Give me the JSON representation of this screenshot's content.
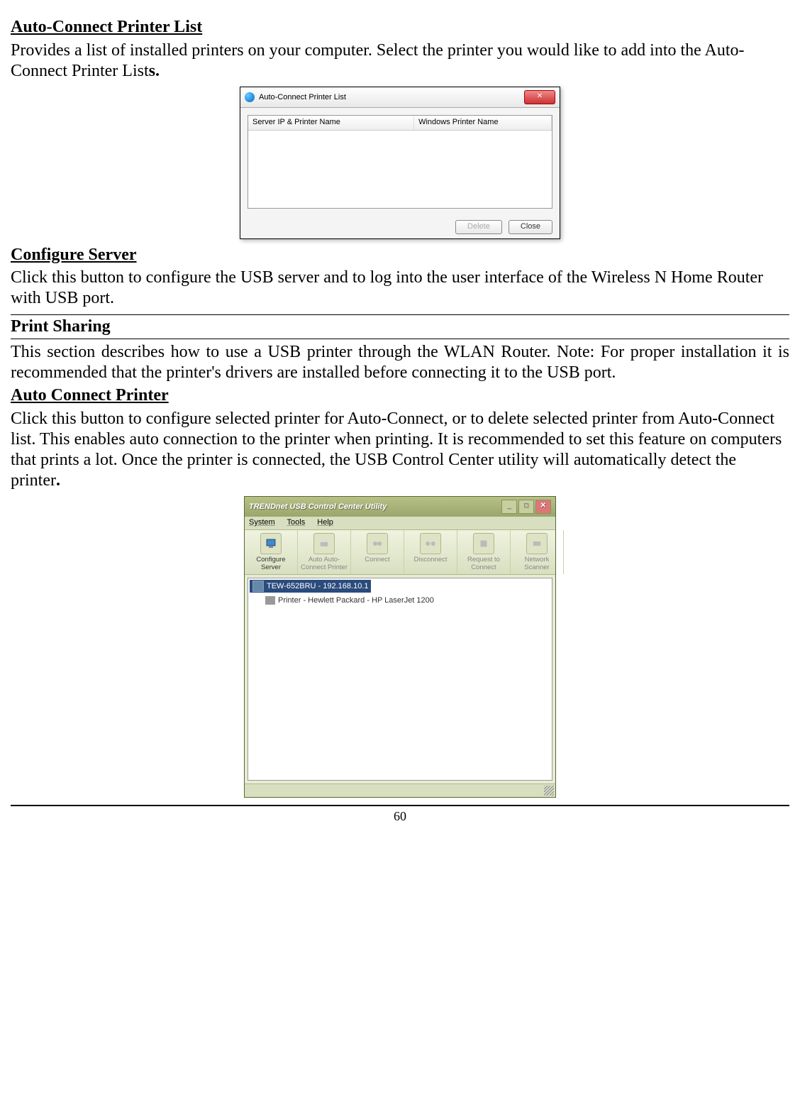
{
  "section1": {
    "heading": "Auto-Connect Printer List",
    "text_a": "Provides a list of installed printers on your computer. Select the printer you would like to add into the Auto-Connect Printer List",
    "text_b": "s."
  },
  "dialog1": {
    "title": "Auto-Connect Printer List",
    "col1": "Server IP & Printer Name",
    "col2": "Windows Printer Name",
    "btn_delete": "Delete",
    "btn_close": "Close"
  },
  "section2": {
    "heading": "Configure Server",
    "text": "Click this button to configure the USB server and to log into the user interface of the Wireless N Home Router with USB port."
  },
  "section3": {
    "heading": "Print Sharing",
    "text": "This section describes how to use a USB printer through the WLAN Router. Note: For proper installation it is recommended that the printer's drivers are installed before connecting it to the USB port."
  },
  "section4": {
    "heading": "Auto Connect Printer",
    "text_a": "Click this button to configure selected printer for Auto-Connect, or to delete selected printer from Auto-Connect list. This enables auto connection to the printer when printing. It is recommended to set this feature on computers that prints a lot. Once the printer is connected, the USB Control Center utility will automatically detect the printer",
    "text_b": "."
  },
  "dialog2": {
    "title": "TRENDnet USB Control Center Utility",
    "menu": {
      "system": "System",
      "tools": "Tools",
      "help": "Help"
    },
    "toolbar": {
      "configure": "Configure Server",
      "auto": "Auto Auto-Connect Printer",
      "connect": "Connect",
      "disconnect": "Disconnect",
      "request": "Request to Connect",
      "scanner": "Network Scanner"
    },
    "tree": {
      "server": "TEW-652BRU - 192.168.10.1",
      "printer": "Printer - Hewlett Packard - HP LaserJet 1200"
    }
  },
  "page_number": "60"
}
